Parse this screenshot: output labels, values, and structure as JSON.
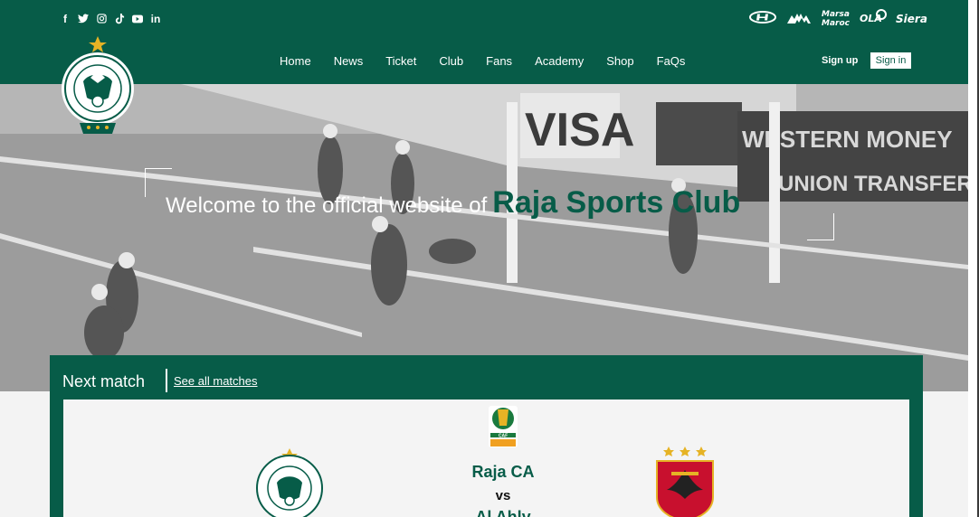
{
  "social": {
    "icons": [
      "facebook-icon",
      "twitter-icon",
      "instagram-icon",
      "tiktok-icon",
      "youtube-icon",
      "linkedin-icon"
    ],
    "glyphs": [
      "f",
      "🐦",
      "◎",
      "♪",
      "▶",
      "in"
    ]
  },
  "sponsors": [
    "Hyundai",
    "Kappa",
    "Marsa Maroc",
    "OLA",
    "Siera"
  ],
  "nav": {
    "items": [
      "Home",
      "News",
      "Ticket",
      "Club",
      "Fans",
      "Academy",
      "Shop",
      "FaQs"
    ]
  },
  "auth": {
    "signup_label": "Sign up",
    "signin_label": "Sign in"
  },
  "logo": {
    "text": "RAJA CLUB ATHLETIC"
  },
  "hero": {
    "welcome_text": "Welcome to the official website of",
    "brand_text": "Raja Sports Club",
    "billboards": [
      "VISA",
      "WESTERN MONEY UNION TRANSFER"
    ]
  },
  "next_match": {
    "title": "Next match",
    "see_all_label": "See all matches",
    "competition": "CAF",
    "home_team": "Raja CA",
    "vs_label": "vs",
    "away_team": "Al Ahly"
  },
  "colors": {
    "brand_green": "#075c48",
    "ahly_red": "#c8102e",
    "gold": "#e6b325"
  }
}
